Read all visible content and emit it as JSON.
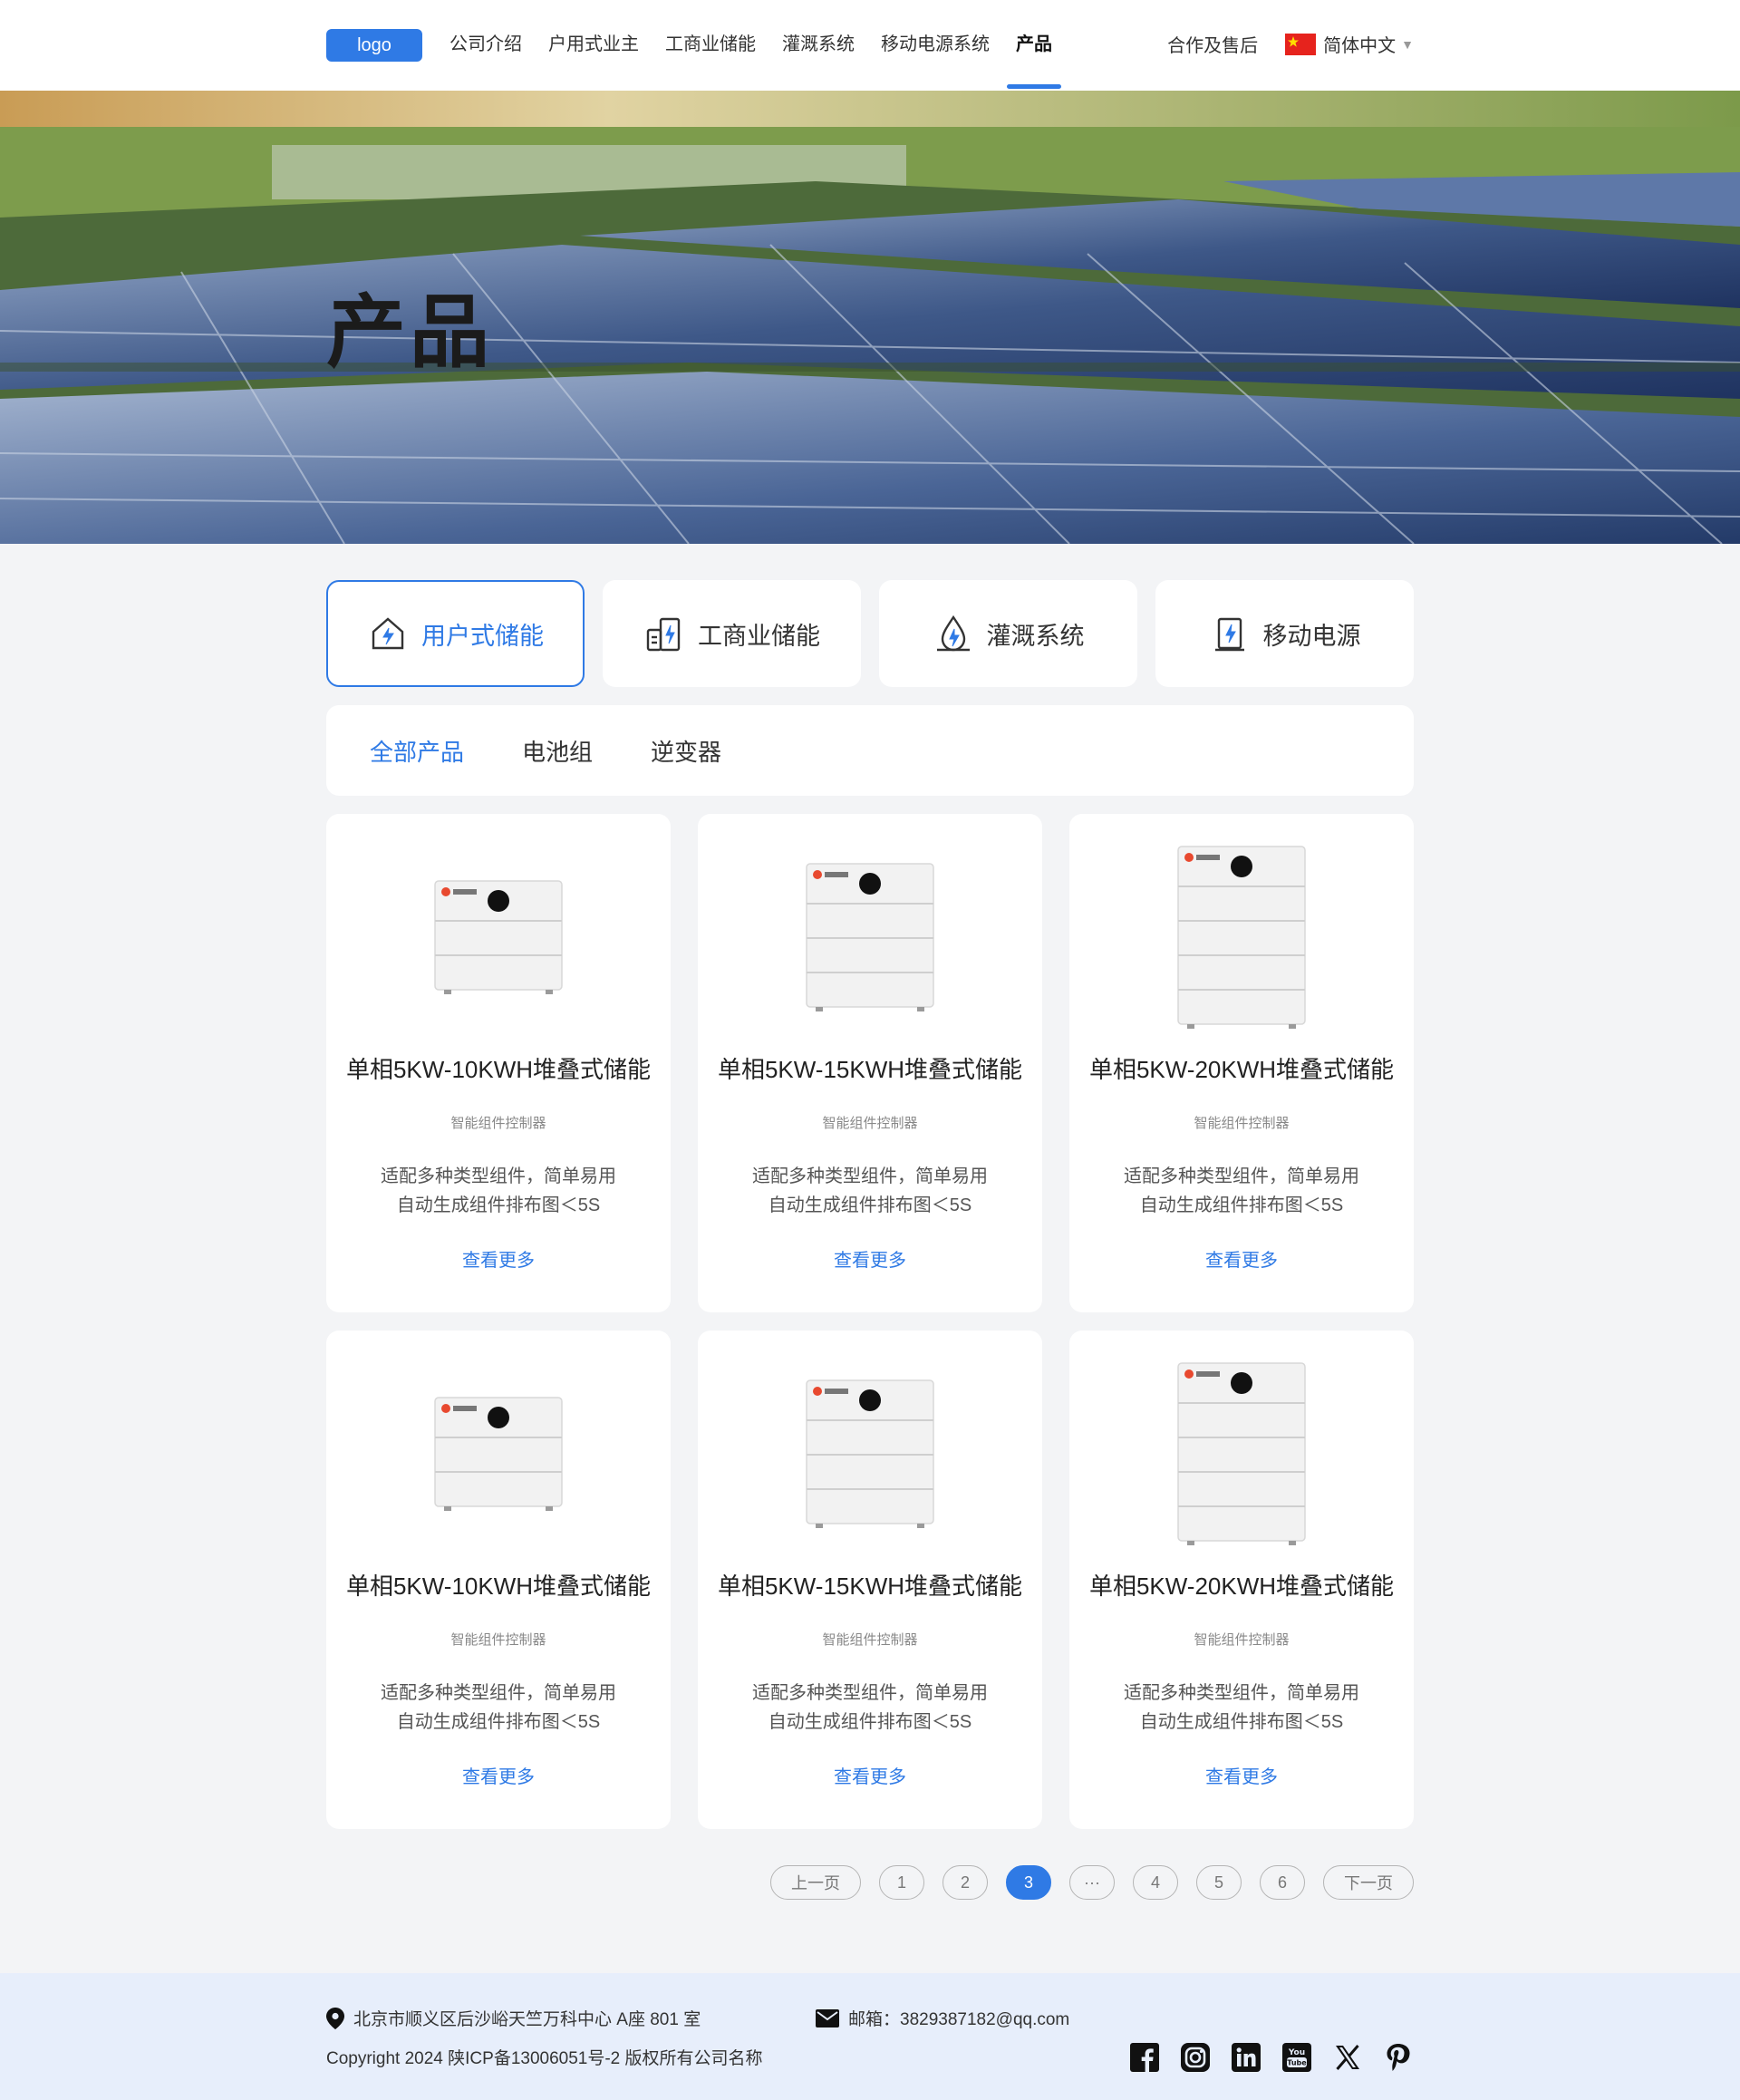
{
  "header": {
    "logo": "logo",
    "nav": [
      "公司介绍",
      "户用式业主",
      "工商业储能",
      "灌溉系统",
      "移动电源系统",
      "产品"
    ],
    "active_nav": 5,
    "partner": "合作及售后",
    "language": "简体中文"
  },
  "hero": {
    "title": "产品"
  },
  "categories": [
    {
      "label": "用户式储能",
      "icon": "home-energy-icon",
      "active": true
    },
    {
      "label": "工商业储能",
      "icon": "commercial-storage-icon",
      "active": false
    },
    {
      "label": "灌溉系统",
      "icon": "irrigation-drop-icon",
      "active": false
    },
    {
      "label": "移动电源",
      "icon": "mobile-power-icon",
      "active": false
    }
  ],
  "filters": [
    {
      "label": "全部产品",
      "active": true
    },
    {
      "label": "电池组",
      "active": false
    },
    {
      "label": "逆变器",
      "active": false
    }
  ],
  "products": [
    {
      "title": "单相5KW-10KWH堆叠式储能",
      "subtitle": "智能组件控制器",
      "desc1": "适配多种类型组件，简单易用",
      "desc2": "自动生成组件排布图＜5S",
      "more": "查看更多",
      "modules": 3
    },
    {
      "title": "单相5KW-15KWH堆叠式储能",
      "subtitle": "智能组件控制器",
      "desc1": "适配多种类型组件，简单易用",
      "desc2": "自动生成组件排布图＜5S",
      "more": "查看更多",
      "modules": 4
    },
    {
      "title": "单相5KW-20KWH堆叠式储能",
      "subtitle": "智能组件控制器",
      "desc1": "适配多种类型组件，简单易用",
      "desc2": "自动生成组件排布图＜5S",
      "more": "查看更多",
      "modules": 5
    },
    {
      "title": "单相5KW-10KWH堆叠式储能",
      "subtitle": "智能组件控制器",
      "desc1": "适配多种类型组件，简单易用",
      "desc2": "自动生成组件排布图＜5S",
      "more": "查看更多",
      "modules": 3
    },
    {
      "title": "单相5KW-15KWH堆叠式储能",
      "subtitle": "智能组件控制器",
      "desc1": "适配多种类型组件，简单易用",
      "desc2": "自动生成组件排布图＜5S",
      "more": "查看更多",
      "modules": 4
    },
    {
      "title": "单相5KW-20KWH堆叠式储能",
      "subtitle": "智能组件控制器",
      "desc1": "适配多种类型组件，简单易用",
      "desc2": "自动生成组件排布图＜5S",
      "more": "查看更多",
      "modules": 5
    }
  ],
  "pagination": {
    "prev": "上一页",
    "pages": [
      "1",
      "2",
      "3",
      "···",
      "4",
      "5",
      "6"
    ],
    "active_page": "3",
    "next": "下一页"
  },
  "footer": {
    "address": "北京市顺义区后沙峪天竺万科中心 A座 801 室",
    "email": "邮箱：3829387182@qq.com",
    "copyright": "Copyright 2024 陕ICP备13006051号-2 版权所有公司名称",
    "social": [
      "facebook-icon",
      "instagram-icon",
      "linkedin-icon",
      "youtube-icon",
      "x-icon",
      "pinterest-icon"
    ]
  },
  "colors": {
    "accent": "#2f7ae5",
    "footer_bg": "#e7eefb",
    "page_bg": "#f3f4f6"
  }
}
